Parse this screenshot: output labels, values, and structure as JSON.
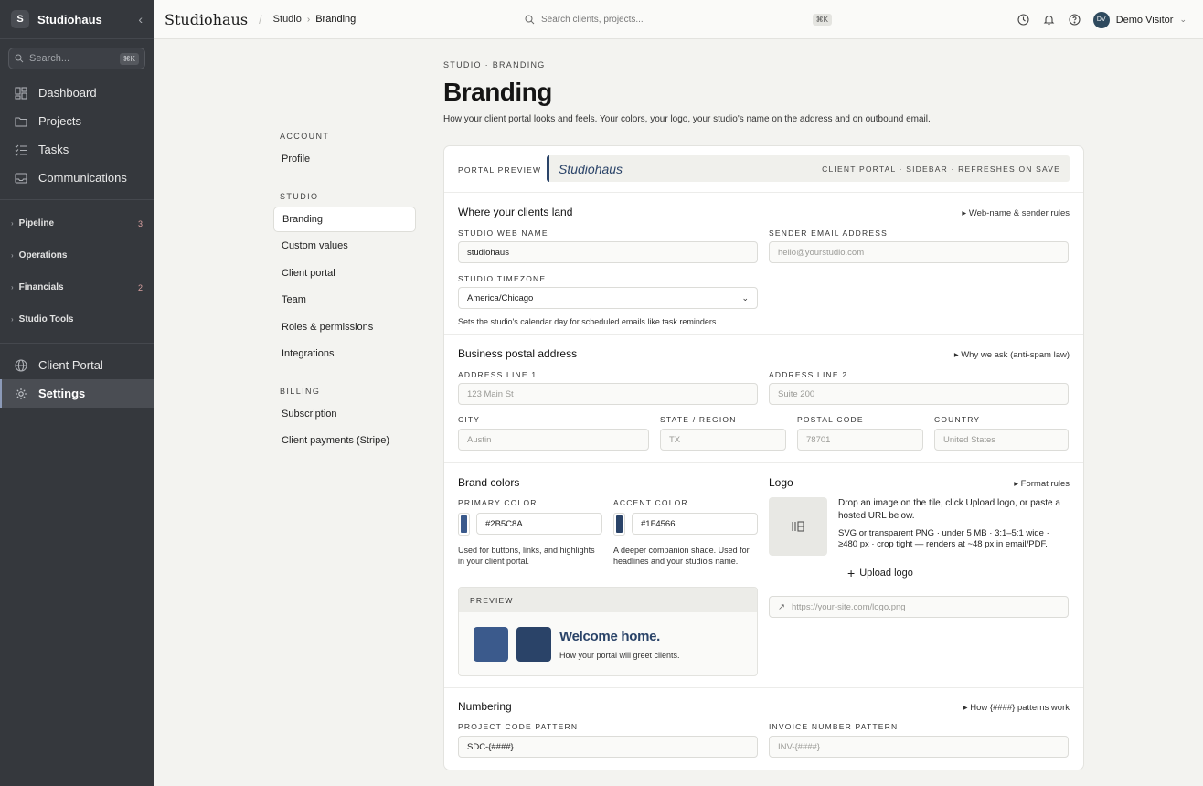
{
  "sidebar": {
    "app_initial": "S",
    "app_name": "Studiohaus",
    "search_placeholder": "Search...",
    "search_kbd": "⌘K",
    "items": [
      {
        "label": "Dashboard"
      },
      {
        "label": "Projects"
      },
      {
        "label": "Tasks"
      },
      {
        "label": "Communications"
      }
    ],
    "groups": [
      {
        "label": "Pipeline",
        "count": "3"
      },
      {
        "label": "Operations",
        "count": ""
      },
      {
        "label": "Financials",
        "count": "2"
      },
      {
        "label": "Studio Tools",
        "count": ""
      }
    ],
    "bottom_items": [
      {
        "label": "Client Portal"
      },
      {
        "label": "Settings"
      }
    ]
  },
  "topbar": {
    "brand": "Studiohaus",
    "crumb_1": "Studio",
    "crumb_2": "Branding",
    "search_placeholder": "Search clients, projects...",
    "search_kbd": "⌘K",
    "avatar_initials": "DV",
    "user_name": "Demo Visitor"
  },
  "settings_nav": {
    "account_heading": "ACCOUNT",
    "account_items": [
      "Profile"
    ],
    "studio_heading": "STUDIO",
    "studio_items": [
      "Branding",
      "Custom values",
      "Client portal",
      "Team",
      "Roles & permissions",
      "Integrations"
    ],
    "billing_heading": "BILLING",
    "billing_items": [
      "Subscription",
      "Client payments (Stripe)"
    ]
  },
  "page": {
    "eyebrow": "STUDIO · BRANDING",
    "title": "Branding",
    "subtitle": "How your client portal looks and feels. Your colors, your logo, your studio's name on the address and on outbound email."
  },
  "preview_bar": {
    "label": "PORTAL PREVIEW",
    "studio_name": "Studiohaus",
    "meta": "CLIENT PORTAL · SIDEBAR · REFRESHES ON SAVE"
  },
  "landing": {
    "heading": "Where your clients land",
    "link": "▸ Web-name & sender rules",
    "web_name_label": "STUDIO WEB NAME",
    "web_name_value": "studiohaus",
    "sender_label": "SENDER EMAIL ADDRESS",
    "sender_placeholder": "hello@yourstudio.com",
    "timezone_label": "STUDIO TIMEZONE",
    "timezone_value": "America/Chicago",
    "timezone_help": "Sets the studio's calendar day for scheduled emails like task reminders."
  },
  "address": {
    "heading": "Business postal address",
    "link": "▸ Why we ask (anti-spam law)",
    "line1_label": "ADDRESS LINE 1",
    "line1_placeholder": "123 Main St",
    "line2_label": "ADDRESS LINE 2",
    "line2_placeholder": "Suite 200",
    "city_label": "CITY",
    "city_placeholder": "Austin",
    "state_label": "STATE / REGION",
    "state_placeholder": "TX",
    "postal_label": "POSTAL CODE",
    "postal_placeholder": "78701",
    "country_label": "COUNTRY",
    "country_placeholder": "United States"
  },
  "colors": {
    "heading": "Brand colors",
    "primary_label": "PRIMARY COLOR",
    "primary_value": "#2B5C8A",
    "primary_swatch": "#3b5a8c",
    "primary_help": "Used for buttons, links, and highlights in your client portal.",
    "accent_label": "ACCENT COLOR",
    "accent_value": "#1F4566",
    "accent_swatch": "#2a4368",
    "accent_help": "A deeper companion shade. Used for headlines and your studio's name.",
    "preview_label": "PREVIEW",
    "preview_title": "Welcome home.",
    "preview_sub": "How your portal will greet clients."
  },
  "logo": {
    "heading": "Logo",
    "link": "▸ Format rules",
    "desc": "Drop an image on the tile, click Upload logo, or paste a hosted URL below.",
    "rules": "SVG or transparent PNG · under 5 MB · 3:1–5:1 wide · ≥480 px · crop tight — renders at ~48 px in email/PDF.",
    "upload_label": "Upload logo",
    "url_placeholder": "https://your-site.com/logo.png"
  },
  "numbering": {
    "heading": "Numbering",
    "link": "▸ How {####} patterns work",
    "project_label": "PROJECT CODE PATTERN",
    "project_value": "SDC-{####}",
    "invoice_label": "INVOICE NUMBER PATTERN",
    "invoice_placeholder": "INV-{####}"
  }
}
